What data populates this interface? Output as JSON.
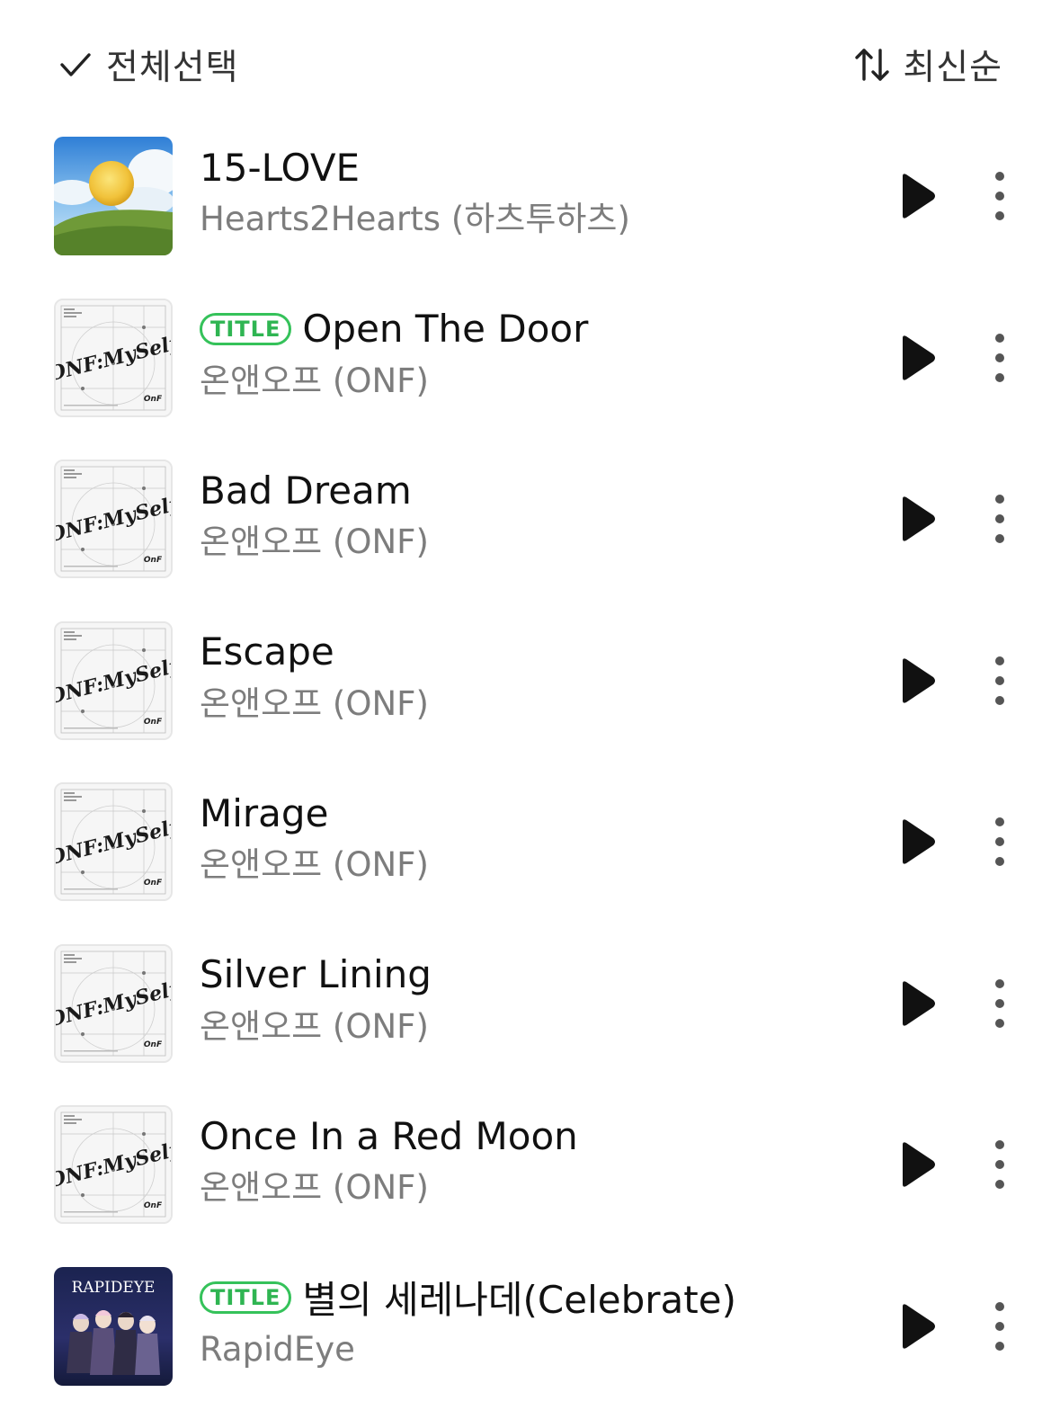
{
  "header": {
    "select_all_label": "전체선택",
    "sort_label": "최신순",
    "check_icon": "check-icon",
    "sort_icon": "sort-arrows-icon"
  },
  "colors": {
    "title_badge": "#35c25a",
    "artist_text": "#7d7d7d",
    "title_text": "#111111"
  },
  "tracks": [
    {
      "title": "15-LOVE",
      "artist": "Hearts2Hearts (하츠투하츠)",
      "badge": "",
      "cover": "sky-lemon"
    },
    {
      "title": "Open The Door",
      "artist": "온앤오프 (ONF)",
      "badge": "TITLE",
      "cover": "onf-myself"
    },
    {
      "title": "Bad Dream",
      "artist": "온앤오프 (ONF)",
      "badge": "",
      "cover": "onf-myself"
    },
    {
      "title": "Escape",
      "artist": "온앤오프 (ONF)",
      "badge": "",
      "cover": "onf-myself"
    },
    {
      "title": "Mirage",
      "artist": "온앤오프 (ONF)",
      "badge": "",
      "cover": "onf-myself"
    },
    {
      "title": "Silver Lining",
      "artist": "온앤오프 (ONF)",
      "badge": "",
      "cover": "onf-myself"
    },
    {
      "title": "Once In a Red Moon",
      "artist": "온앤오프 (ONF)",
      "badge": "",
      "cover": "onf-myself"
    },
    {
      "title": "별의 세레나데(Celebrate)",
      "artist": "RapidEye",
      "badge": "TITLE",
      "cover": "rapideye",
      "cover_text": "RAPIDEYE"
    }
  ]
}
